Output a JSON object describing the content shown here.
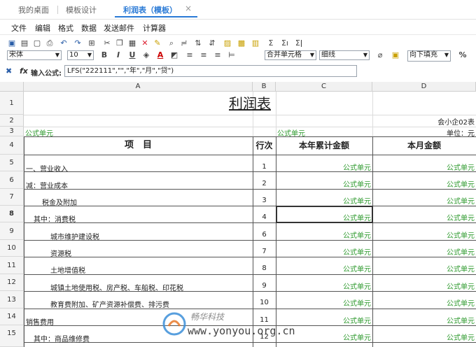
{
  "tabs": {
    "desktop": "我的桌面",
    "template_design": "模板设计",
    "active": "利润表（模板）",
    "close": "×"
  },
  "menu": [
    "文件",
    "编辑",
    "格式",
    "数据",
    "发送邮件",
    "计算器"
  ],
  "toolbar": {
    "font": "宋体",
    "size": "10",
    "bold": "B",
    "italic": "I",
    "underline": "U",
    "merge": "合并单元格",
    "border": "细线",
    "fill": "向下填充",
    "percent": "%"
  },
  "formula": {
    "label": "输入公式:",
    "value": "LFS(\"222111\",\"\",\"年\",\"月\",\"贷\")"
  },
  "columns": [
    "A",
    "B",
    "C",
    "D"
  ],
  "sheet": {
    "title": "利润表",
    "form_no": "会小企02表",
    "unit_label": "单位：元",
    "formula_cell": "公式单元",
    "header_item": "项　目",
    "header_row": "行次",
    "header_year": "本年累计金额",
    "header_month": "本月金额",
    "rows": [
      {
        "num": "5",
        "item": "一、营业收入",
        "line": "1"
      },
      {
        "num": "6",
        "item": "减：营业成本",
        "line": "2"
      },
      {
        "num": "7",
        "item": "税金及附加",
        "line": "3"
      },
      {
        "num": "8",
        "item": "其中：消费税",
        "line": "4"
      },
      {
        "num": "9",
        "item": "城市维护建设税",
        "line": "6"
      },
      {
        "num": "10",
        "item": "资源税",
        "line": "7"
      },
      {
        "num": "11",
        "item": "土地增值税",
        "line": "8"
      },
      {
        "num": "12",
        "item": "城镇土地使用税、房产税、车船税、印花税",
        "line": "9"
      },
      {
        "num": "13",
        "item": "教育费附加、矿产资源补偿费、排污费",
        "line": "10"
      },
      {
        "num": "14",
        "item": "销售费用",
        "line": "11"
      },
      {
        "num": "15",
        "item": "其中：商品维修费",
        "line": "12"
      }
    ]
  },
  "watermark": {
    "brand": "畅华科技",
    "url": "www.yonyou.org.cn"
  }
}
